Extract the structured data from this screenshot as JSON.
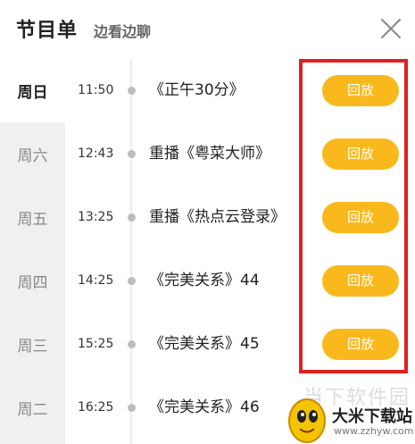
{
  "header": {
    "title": "节目单",
    "subtitle": "边看边聊"
  },
  "days": [
    {
      "label": "周日",
      "active": true
    },
    {
      "label": "周六",
      "active": false
    },
    {
      "label": "周五",
      "active": false
    },
    {
      "label": "周四",
      "active": false
    },
    {
      "label": "周三",
      "active": false
    },
    {
      "label": "周二",
      "active": false
    }
  ],
  "programs": [
    {
      "time": "11:50",
      "title": "《正午30分》",
      "button": "回放"
    },
    {
      "time": "12:43",
      "title": "重播《粤菜大师》",
      "button": "回放"
    },
    {
      "time": "13:25",
      "title": "重播《热点云登录》",
      "button": "回放"
    },
    {
      "time": "14:25",
      "title": "《完美关系》44",
      "button": "回放"
    },
    {
      "time": "15:25",
      "title": "《完美关系》45",
      "button": "回放"
    },
    {
      "time": "16:25",
      "title": "《完美关系》46",
      "button": ""
    }
  ],
  "watermark": {
    "faded_text": "当下软件园",
    "site_name": "大米下载站",
    "site_url": "www.zzhyw.com"
  },
  "colors": {
    "button": "#f9b91c",
    "highlight_box": "#e02020",
    "sidebar": "#f0f0f0"
  }
}
